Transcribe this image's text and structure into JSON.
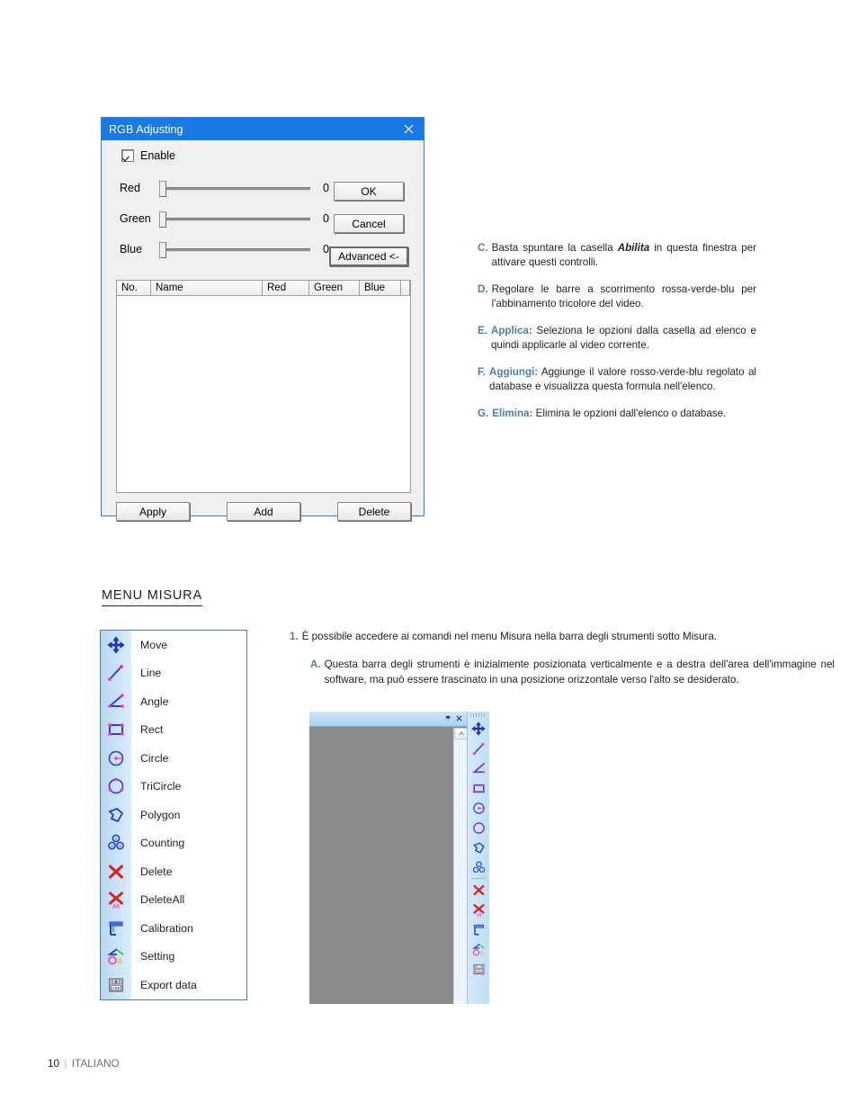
{
  "page": {
    "footer_page": "10",
    "footer_sep": "|",
    "footer_lang": "ITALIANO"
  },
  "rgb_dialog": {
    "title": "RGB Adjusting",
    "close_icon": "close-icon",
    "enable_label": "Enable",
    "enable_checked": true,
    "sliders": [
      {
        "label": "Red",
        "value": "0"
      },
      {
        "label": "Green",
        "value": "0"
      },
      {
        "label": "Blue",
        "value": "0"
      }
    ],
    "buttons": {
      "ok": "OK",
      "cancel": "Cancel",
      "advanced": "Advanced <-"
    },
    "list_columns": [
      "No.",
      "Name",
      "Red",
      "Green",
      "Blue"
    ],
    "list_rows": [],
    "bottom_buttons": {
      "apply": "Apply",
      "add": "Add",
      "delete": "Delete"
    },
    "accent_color": "#1a7ae4"
  },
  "instructions": [
    {
      "marker": "C.",
      "pre": "Basta spuntare la casella ",
      "bold": "Abilita",
      "post": " in questa finestra per attivare questi controlli."
    },
    {
      "marker": "D.",
      "pre": "",
      "bold": "",
      "post": "Regolare le barre a scorrimento rossa-verde-blu per l'abbinamento tricolore del video."
    },
    {
      "marker": "E.",
      "highlight": "Applica:",
      "post": " Seleziona le opzioni dalla casella ad elenco e quindi applicarle al video corrente."
    },
    {
      "marker": "F.",
      "highlight": "Aggiungi:",
      "post": " Aggiunge il valore rosso-verde-blu regolato al database e visualizza questa formula nell'elenco."
    },
    {
      "marker": "G.",
      "highlight": "Elimina:",
      "post": " Elimina le opzioni dall'elenco o database."
    }
  ],
  "section": {
    "heading": "MENU MISURA"
  },
  "measure_menu": {
    "items": [
      {
        "label": "Move",
        "icon": "move-arrows-icon"
      },
      {
        "label": "Line",
        "icon": "line-icon"
      },
      {
        "label": "Angle",
        "icon": "angle-icon"
      },
      {
        "label": "Rect",
        "icon": "rectangle-icon"
      },
      {
        "label": "Circle",
        "icon": "circle-radius-icon"
      },
      {
        "label": "TriCircle",
        "icon": "tricircle-icon"
      },
      {
        "label": "Polygon",
        "icon": "polygon-icon"
      },
      {
        "label": "Counting",
        "icon": "counting-icon"
      },
      {
        "label": "Delete",
        "icon": "delete-x-icon"
      },
      {
        "label": "DeleteAll",
        "icon": "delete-all-icon"
      },
      {
        "label": "Calibration",
        "icon": "calibration-ruler-icon"
      },
      {
        "label": "Setting",
        "icon": "setting-icon"
      },
      {
        "label": "Export data",
        "icon": "export-csv-icon"
      }
    ]
  },
  "software_shot": {
    "titlebar_icons": [
      "pin-icon",
      "close-icon"
    ],
    "scrollbar_up_icon": "chevron-up-icon",
    "toolbar_icons": [
      "move-arrows-icon",
      "line-icon",
      "angle-icon",
      "rectangle-icon",
      "circle-radius-icon",
      "tricircle-icon",
      "polygon-icon",
      "counting-icon",
      "delete-x-icon",
      "delete-all-icon",
      "calibration-ruler-icon",
      "setting-icon",
      "export-csv-icon"
    ],
    "canvas_color": "#8b8b8b"
  },
  "misura_instructions": {
    "item1_marker": "1.",
    "item1_text": "È possibile accedere ai comandi nel menu Misura nella barra degli strumenti sotto Misura.",
    "itemA_marker": "A.",
    "itemA_text": "Questa barra degli strumenti è inizialmente posizionata verticalmente e a destra dell'area dell'immagine nel software, ma può essere trascinato in una posizione orizzontale verso l'alto se desiderato."
  }
}
